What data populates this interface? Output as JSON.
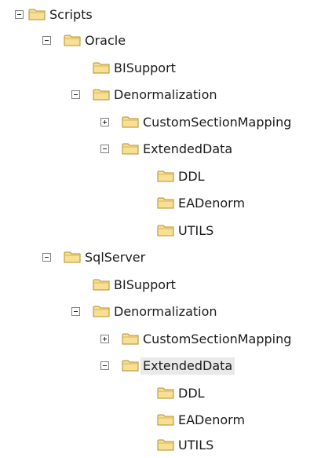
{
  "tree": {
    "nodes": [
      {
        "label": "Scripts",
        "state": "expanded",
        "icon": "folder-icon"
      },
      {
        "label": "Oracle",
        "state": "expanded",
        "icon": "folder-icon"
      },
      {
        "label": "BISupport",
        "state": "leaf",
        "icon": "folder-icon"
      },
      {
        "label": "Denormalization",
        "state": "expanded",
        "icon": "folder-icon"
      },
      {
        "label": "CustomSectionMapping",
        "state": "collapsed",
        "icon": "folder-icon"
      },
      {
        "label": "ExtendedData",
        "state": "expanded",
        "icon": "folder-icon"
      },
      {
        "label": "DDL",
        "state": "leaf",
        "icon": "folder-icon"
      },
      {
        "label": "EADenorm",
        "state": "leaf",
        "icon": "folder-icon"
      },
      {
        "label": "UTILS",
        "state": "leaf",
        "icon": "folder-icon"
      },
      {
        "label": "SqlServer",
        "state": "expanded",
        "icon": "folder-icon"
      },
      {
        "label": "BISupport",
        "state": "leaf",
        "icon": "folder-icon"
      },
      {
        "label": "Denormalization",
        "state": "expanded",
        "icon": "folder-icon"
      },
      {
        "label": "CustomSectionMapping",
        "state": "collapsed",
        "icon": "folder-icon"
      },
      {
        "label": "ExtendedData",
        "state": "expanded",
        "icon": "folder-icon",
        "selected": true
      },
      {
        "label": "DDL",
        "state": "leaf",
        "icon": "folder-icon"
      },
      {
        "label": "EADenorm",
        "state": "leaf",
        "icon": "folder-icon"
      },
      {
        "label": "UTILS",
        "state": "leaf",
        "icon": "folder-icon"
      }
    ]
  },
  "colors": {
    "folder_fill": "#f7df93",
    "folder_stroke": "#b48d2a",
    "selection": "#e9e9e9"
  }
}
